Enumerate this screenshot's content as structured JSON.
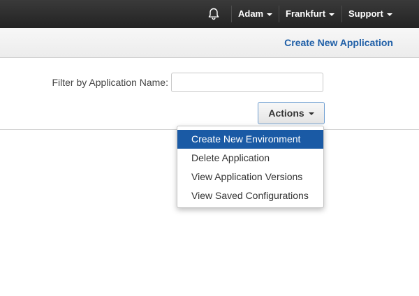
{
  "topnav": {
    "notifications_icon": "bell-icon",
    "user": "Adam",
    "region": "Frankfurt",
    "support": "Support"
  },
  "subnav": {
    "create_application": "Create New Application"
  },
  "filter": {
    "label": "Filter by Application Name:",
    "value": "",
    "placeholder": ""
  },
  "actions": {
    "label": "Actions",
    "items": [
      {
        "label": "Create New Environment",
        "highlighted": true
      },
      {
        "label": "Delete Application",
        "highlighted": false
      },
      {
        "label": "View Application Versions",
        "highlighted": false
      },
      {
        "label": "View Saved Configurations",
        "highlighted": false
      }
    ]
  },
  "colors": {
    "topbar": "#2b2b2b",
    "link": "#1f5fa7",
    "highlight": "#1a5aa5"
  }
}
